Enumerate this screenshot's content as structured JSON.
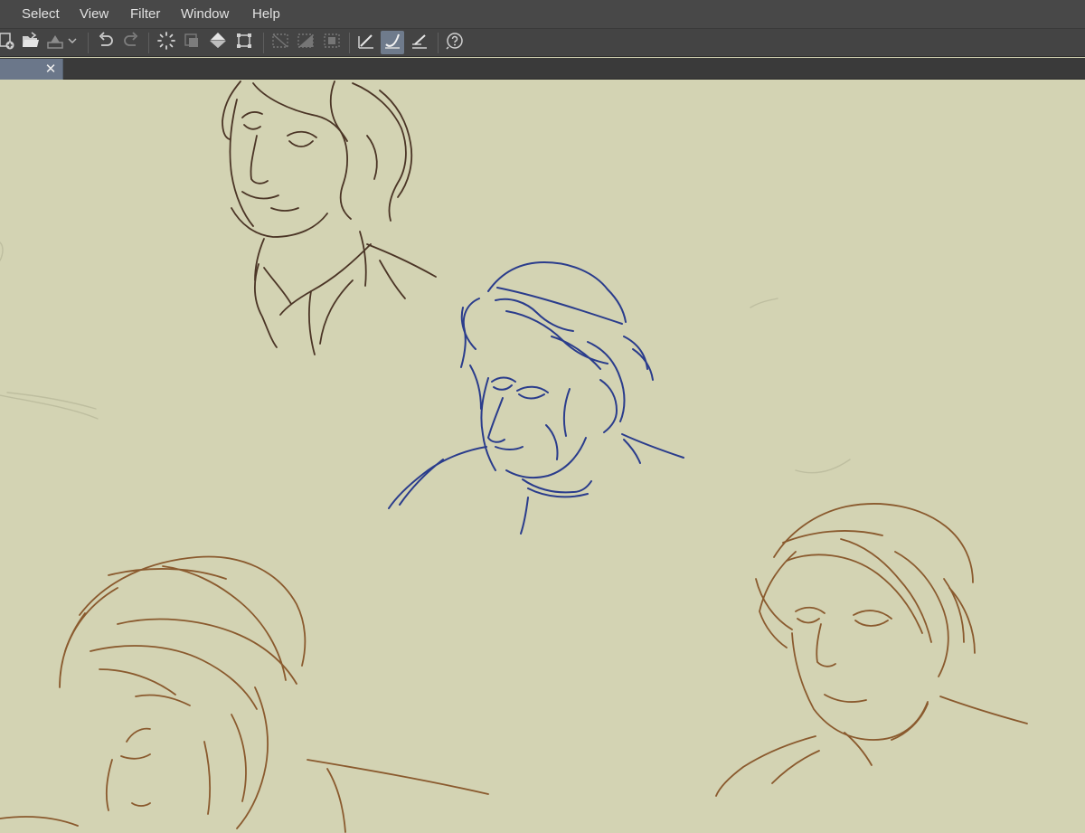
{
  "menu": {
    "items": [
      {
        "label": "Select"
      },
      {
        "label": "View"
      },
      {
        "label": "Filter"
      },
      {
        "label": "Window"
      },
      {
        "label": "Help"
      }
    ]
  },
  "toolbar": {
    "buttons": [
      {
        "icon": "new-canvas-icon"
      },
      {
        "icon": "open-folder-icon"
      },
      {
        "icon": "save-icon"
      },
      {
        "icon": "chevron-down-icon"
      },
      {
        "icon": "undo-icon"
      },
      {
        "icon": "redo-icon"
      },
      {
        "icon": "loading-spinner-icon"
      },
      {
        "icon": "clear-layer-icon"
      },
      {
        "icon": "fill-icon"
      },
      {
        "icon": "transform-icon"
      },
      {
        "icon": "hide-selection-icon"
      },
      {
        "icon": "invert-selection-icon"
      },
      {
        "icon": "crop-icon"
      },
      {
        "icon": "snap-ruler-icon"
      },
      {
        "icon": "snap-special-ruler-icon",
        "active": true
      },
      {
        "icon": "snap-grid-icon"
      },
      {
        "icon": "help-icon"
      }
    ]
  },
  "document_tab": {
    "title": "",
    "close_glyph": "✕"
  },
  "canvas": {
    "background_color": "#d3d3b3",
    "sketch_colors": {
      "dark": "#4b3526",
      "blue": "#2a3c8c",
      "brown": "#8a5a2e"
    },
    "sketches": [
      {
        "name": "sketch-man-top",
        "color": "dark"
      },
      {
        "name": "sketch-woman-blue",
        "color": "blue"
      },
      {
        "name": "sketch-woman-right",
        "color": "brown"
      },
      {
        "name": "sketch-man-bottom-left",
        "color": "brown"
      }
    ]
  }
}
